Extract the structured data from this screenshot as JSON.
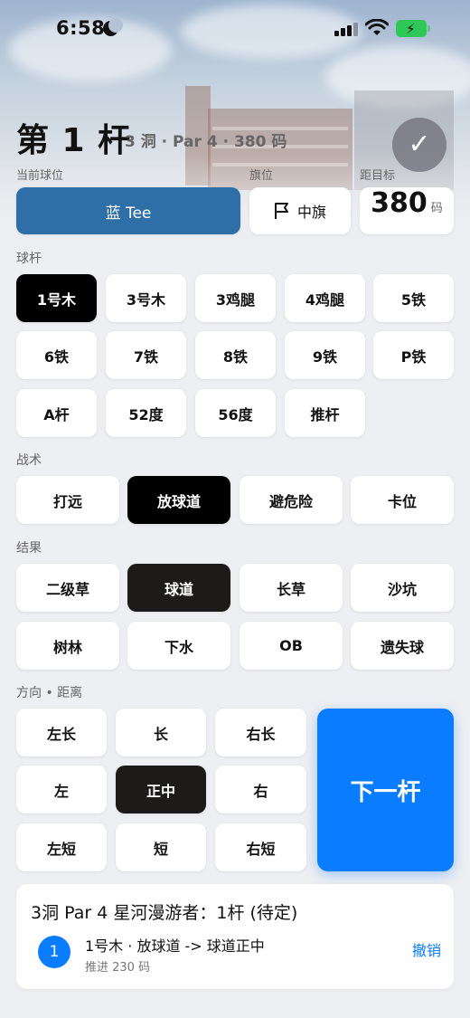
{
  "status_bar": {
    "time": "6:58",
    "battery_color": "#30c759"
  },
  "header": {
    "title": "第 1 杆",
    "subtitle": "3 洞 · Par 4 · 380 码",
    "confirm_icon": "checkmark-icon"
  },
  "labels": {
    "current_tee": "当前球位",
    "flag": "旗位",
    "distance": "距目标"
  },
  "tee": {
    "label": "蓝 Tee",
    "color": "#2d6fa6"
  },
  "flag": {
    "label": "中旗"
  },
  "distance": {
    "value": "380",
    "unit": "码"
  },
  "clubs": {
    "label": "球杆",
    "items": [
      "1号木",
      "3号木",
      "3鸡腿",
      "4鸡腿",
      "5铁",
      "6铁",
      "7铁",
      "8铁",
      "9铁",
      "P铁",
      "A杆",
      "52度",
      "56度",
      "推杆"
    ],
    "selected": "1号木"
  },
  "tactics": {
    "label": "战术",
    "items": [
      "打远",
      "放球道",
      "避危险",
      "卡位"
    ],
    "selected": "放球道"
  },
  "result": {
    "label": "结果",
    "items": [
      "二级草",
      "球道",
      "长草",
      "沙坑",
      "树林",
      "下水",
      "OB",
      "遗失球"
    ],
    "selected": "球道"
  },
  "direction": {
    "label": "方向 • 距离",
    "items": [
      "左长",
      "长",
      "右长",
      "左",
      "正中",
      "右",
      "左短",
      "短",
      "右短"
    ],
    "selected": "正中"
  },
  "next_button": {
    "label": "下一杆",
    "color": "#0a7cff"
  },
  "summary": {
    "title": "3洞  Par 4   星河漫游者：1杆 (待定)",
    "shots": [
      {
        "number": "1",
        "description": "1号木 · 放球道 -> 球道正中",
        "detail": "推进 230 码",
        "undo": "撤销"
      }
    ]
  }
}
